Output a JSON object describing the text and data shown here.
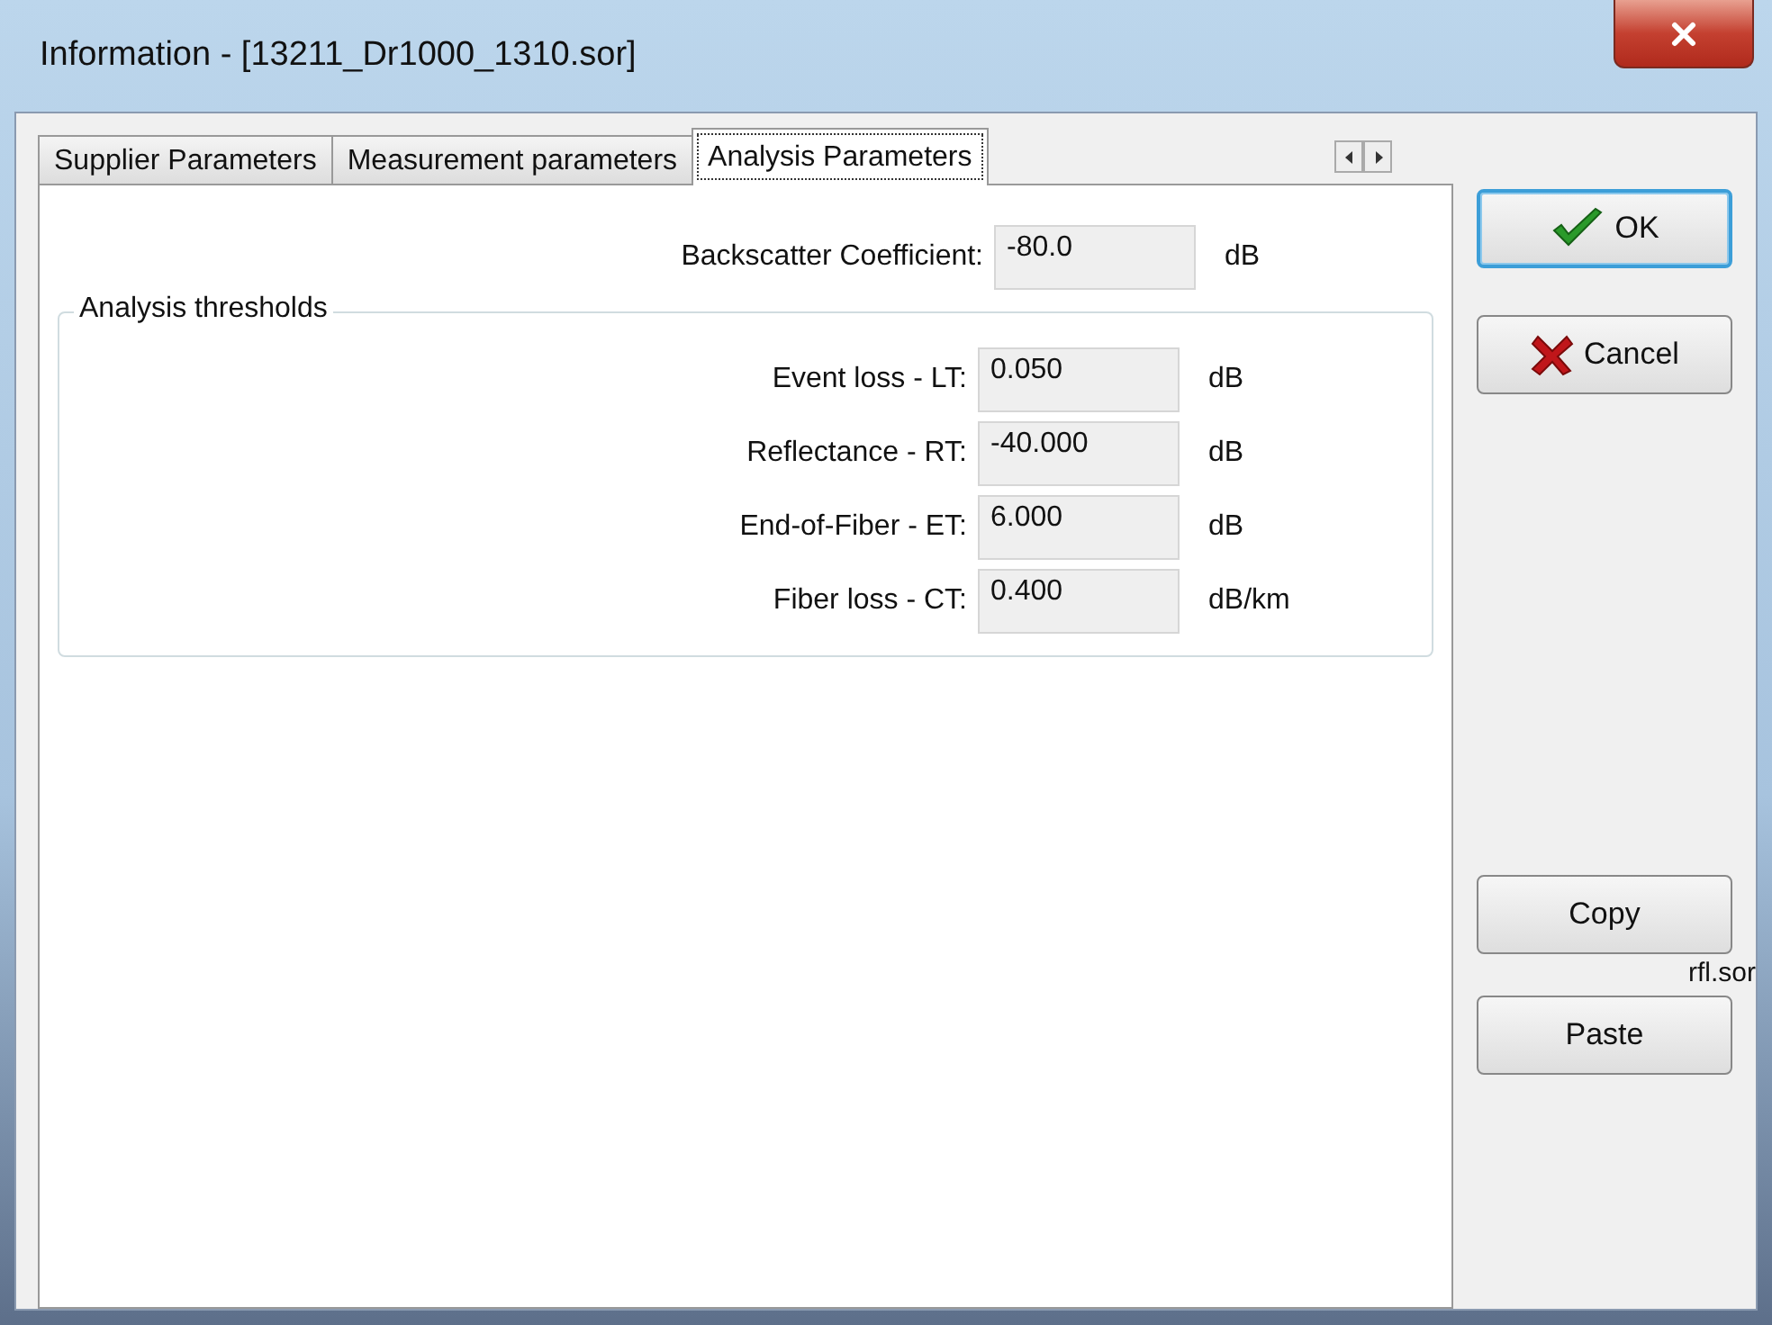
{
  "window": {
    "title": "Information - [13211_Dr1000_1310.sor]"
  },
  "tabs": [
    {
      "label": "Supplier Parameters",
      "selected": false
    },
    {
      "label": "Measurement parameters",
      "selected": false
    },
    {
      "label": "Analysis Parameters",
      "selected": true
    }
  ],
  "backscatter": {
    "label": "Backscatter Coefficient:",
    "value": "-80.0",
    "unit": "dB"
  },
  "thresholds": {
    "title": "Analysis thresholds",
    "rows": [
      {
        "label": "Event loss - LT:",
        "value": "0.050",
        "unit": "dB"
      },
      {
        "label": "Reflectance - RT:",
        "value": "-40.000",
        "unit": "dB"
      },
      {
        "label": "End-of-Fiber - ET:",
        "value": "6.000",
        "unit": "dB"
      },
      {
        "label": "Fiber loss - CT:",
        "value": "0.400",
        "unit": "dB/km"
      }
    ]
  },
  "buttons": [
    {
      "label": "OK",
      "kind": "ok"
    },
    {
      "label": "Cancel",
      "kind": "cancel"
    }
  ],
  "copy": {
    "label": "Copy",
    "caption": "rfl.sor"
  },
  "paste": {
    "label": "Paste"
  }
}
